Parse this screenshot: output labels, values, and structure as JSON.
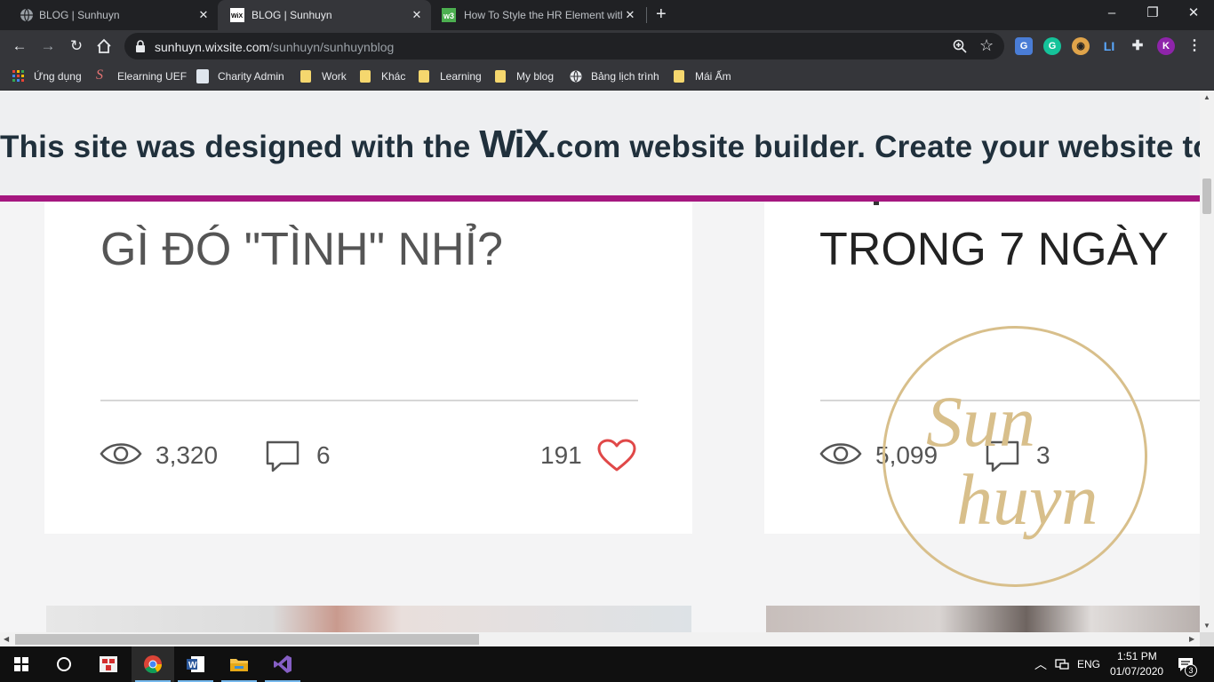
{
  "browser": {
    "tabs": [
      {
        "title": "BLOG | Sunhuyn",
        "icon": "globe-icon",
        "active": false
      },
      {
        "title": "BLOG | Sunhuyn",
        "icon": "wix-icon",
        "active": true
      },
      {
        "title": "How To Style the HR Element with",
        "icon": "w3schools-icon",
        "active": false
      }
    ],
    "new_tab": "+",
    "window_controls": {
      "minimize": "–",
      "maximize": "❐",
      "close": "✕"
    },
    "address": {
      "host": "sunhuyn.wixsite.com",
      "path": "/sunhuyn/sunhuynblog"
    },
    "profile_initial": "K",
    "bookmarks": [
      {
        "label": "Ứng dụng",
        "icon": "apps-grid-icon"
      },
      {
        "label": "Elearning UEF",
        "icon": "elearning-icon"
      },
      {
        "label": "Charity Admin",
        "icon": "page-icon"
      },
      {
        "label": "Work",
        "icon": "folder-icon"
      },
      {
        "label": "Khác",
        "icon": "folder-icon"
      },
      {
        "label": "Learning",
        "icon": "folder-icon"
      },
      {
        "label": "My blog",
        "icon": "folder-icon"
      },
      {
        "label": "Bảng lịch trình",
        "icon": "globe-icon"
      },
      {
        "label": "Mái Ấm",
        "icon": "folder-icon"
      }
    ]
  },
  "banner": {
    "before": "This site was designed with the ",
    "logo": "WiX",
    "after": ".com website builder. Create your website toda",
    "accent_color": "#a5177f"
  },
  "posts": [
    {
      "title": "GÌ ĐÓ \"TÌNH\" NHỈ?",
      "views": "3,320",
      "comments": "6",
      "likes": "191"
    },
    {
      "title": "TRONG 7 NGÀY",
      "views": "5,099",
      "comments": "3"
    }
  ],
  "watermark": {
    "line1": "Sun",
    "line2": "huyn",
    "color": "#d8bf8b"
  },
  "taskbar": {
    "apps": [
      "windows-start-icon",
      "cortana-icon",
      "snipping-icon",
      "chrome-icon",
      "word-icon",
      "file-explorer-icon",
      "visual-studio-icon"
    ],
    "language": "ENG",
    "time": "1:51 PM",
    "date": "01/07/2020",
    "notifications": "3"
  }
}
